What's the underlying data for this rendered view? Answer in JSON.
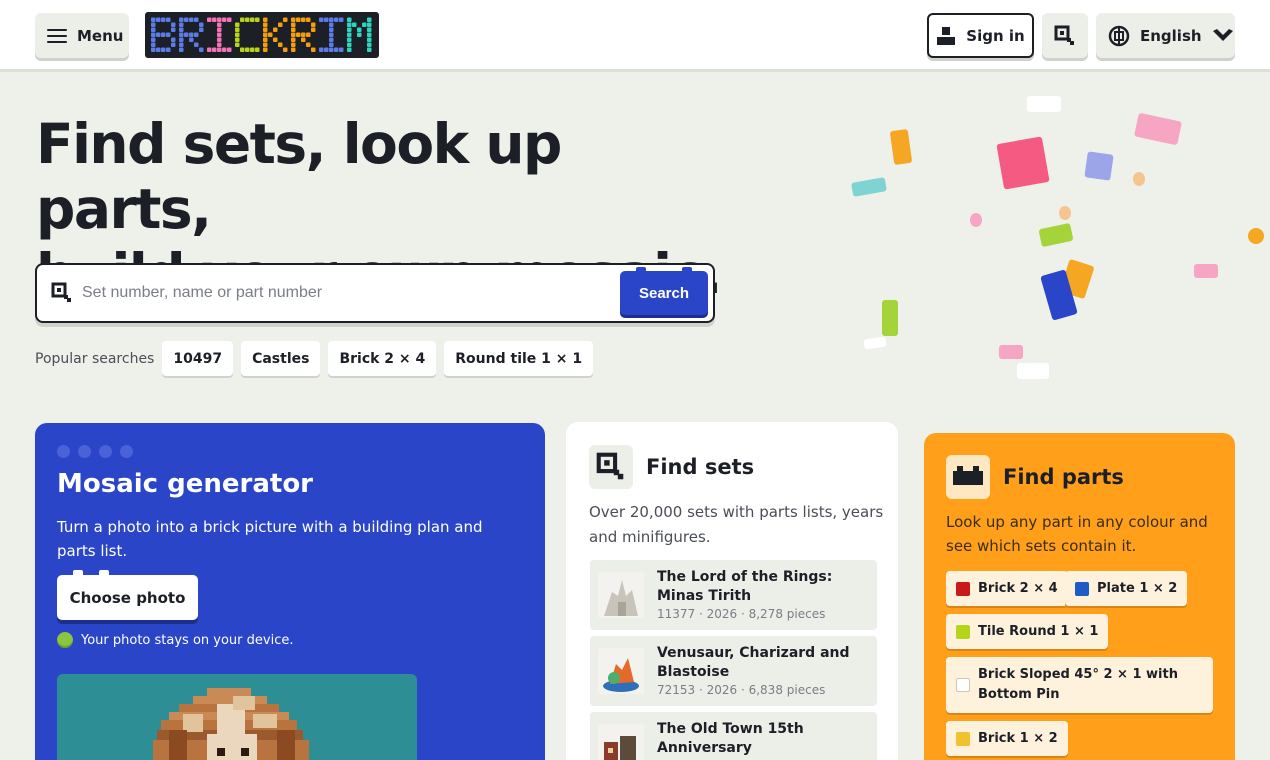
{
  "header": {
    "menu_label": "Menu",
    "logo_text": "BRICKRIM",
    "signin_label": "Sign in",
    "language_label": "English"
  },
  "hero": {
    "title_line1": "Find sets, look up parts,",
    "title_line2": "build your own mosaic.",
    "search_placeholder": "Set number, name or part number",
    "search_button": "Search",
    "popular_label": "Popular searches",
    "popular": [
      "10497",
      "Castles",
      "Brick 2 × 4",
      "Round tile 1 × 1"
    ]
  },
  "mosaic_card": {
    "title": "Mosaic generator",
    "description": "Turn a photo into a brick picture with a building plan and parts list.",
    "button": "Choose photo",
    "privacy_note": "Your photo stays on your device.",
    "bg_color": "#2b45c9"
  },
  "sets_card": {
    "title": "Find sets",
    "description": "Over 20,000 sets with parts lists, years and minifigures.",
    "items": [
      {
        "name": "The Lord of the Rings: Minas Tirith",
        "meta": "11377 · 2026 · 8,278 pieces"
      },
      {
        "name": "Venusaur, Charizard and Blastoise",
        "meta": "72153 · 2026 · 6,838 pieces"
      },
      {
        "name": "The Old Town 15th Anniversary",
        "meta": ""
      }
    ]
  },
  "parts_card": {
    "title": "Find parts",
    "description": "Look up any part in any colour and see which sets contain it.",
    "bg_color": "#ff9f1a",
    "parts": [
      {
        "name": "Brick 2 × 4",
        "color": "#c91a1a"
      },
      {
        "name": "Plate 1 × 2",
        "color": "#1e5bc6"
      },
      {
        "name": "Tile Round 1 × 1",
        "color": "#b8d41a"
      },
      {
        "name": "Brick Sloped 45° 2 × 1 with Bottom Pin",
        "color": "#ffffff"
      },
      {
        "name": "Brick 1 × 2",
        "color": "#f2c12e"
      }
    ]
  }
}
